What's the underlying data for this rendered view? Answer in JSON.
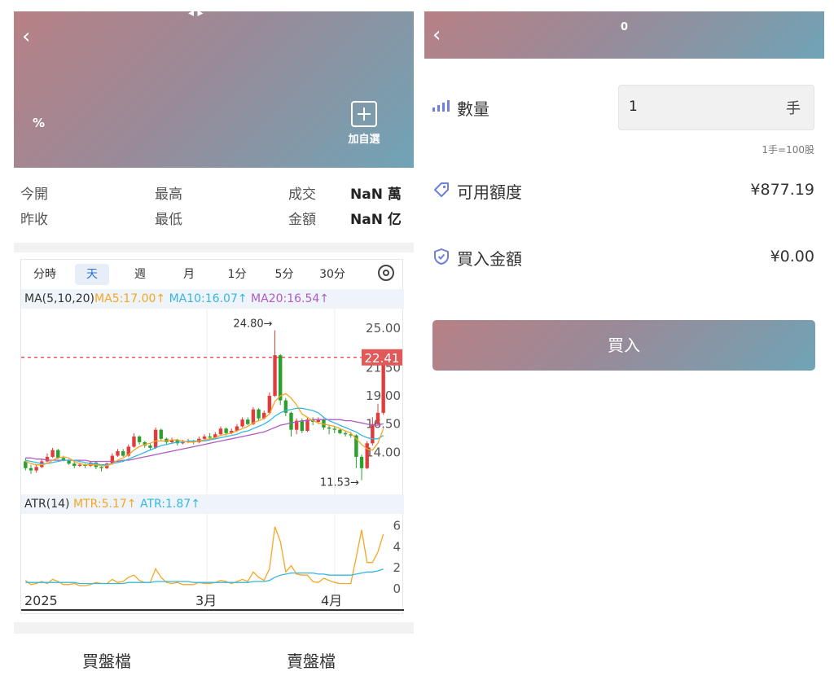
{
  "left": {
    "header": {
      "percent": "%",
      "add_favorite": "加自選"
    },
    "stats": {
      "open_label": "今開",
      "high_label": "最高",
      "volume_label": "成交",
      "volume_value": "NaN 萬",
      "prev_close_label": "昨收",
      "low_label": "最低",
      "amount_label": "金額",
      "amount_value": "NaN 亿"
    },
    "chart_tabs": [
      "分時",
      "天",
      "週",
      "月",
      "1分",
      "5分",
      "30分"
    ],
    "active_tab": "天",
    "ma_legend": {
      "name": "MA(5,10,20)",
      "ma5": "MA5:17.00↑",
      "ma10": "MA10:16.07↑",
      "ma20": "MA20:16.54↑"
    },
    "atr_legend": {
      "name": "ATR(14)",
      "mtr": "MTR:5.17↑",
      "atr": "ATR:1.87↑"
    },
    "bottom_tabs": {
      "buy": "買盤檔",
      "sell": "賣盤檔"
    },
    "colors": {
      "up": "#e23b3b",
      "down": "#2ca02c",
      "ma5": "#f5a623",
      "ma10": "#35b7e0",
      "ma20": "#b05bc0"
    }
  },
  "right": {
    "title": "0",
    "quantity_label": "數量",
    "quantity_value": "1",
    "quantity_unit": "手",
    "quantity_hint": "1手=100股",
    "available_label": "可用額度",
    "available_value": "¥877.19",
    "buy_amount_label": "買入金額",
    "buy_amount_value": "¥0.00",
    "buy_button": "買入"
  },
  "chart_data": [
    {
      "type": "candlestick",
      "title": "",
      "ylim": [
        11,
        26
      ],
      "y_ticks": [
        "25.00",
        "21.50",
        "19.00",
        "16.50",
        "14.00"
      ],
      "current_price": "22.41",
      "max_label": "24.80→",
      "min_label": "11.53→",
      "x_labels": [
        "2025",
        "3月",
        "4月"
      ],
      "candles": [
        [
          13.2,
          12.6,
          13.5,
          12.4
        ],
        [
          12.6,
          12.4,
          12.9,
          12.1
        ],
        [
          12.4,
          12.7,
          12.9,
          12.2
        ],
        [
          12.7,
          13.2,
          13.4,
          12.6
        ],
        [
          13.2,
          13.6,
          13.9,
          13.1
        ],
        [
          13.6,
          14.2,
          14.4,
          13.5
        ],
        [
          14.2,
          13.5,
          14.3,
          13.4
        ],
        [
          13.5,
          13.3,
          13.7,
          13.2
        ],
        [
          13.3,
          13.0,
          13.4,
          12.9
        ],
        [
          13.0,
          12.8,
          13.2,
          12.6
        ],
        [
          12.8,
          12.9,
          13.1,
          12.7
        ],
        [
          12.9,
          12.8,
          13.0,
          12.6
        ],
        [
          12.8,
          13.1,
          13.2,
          12.7
        ],
        [
          13.1,
          12.7,
          13.2,
          12.5
        ],
        [
          12.7,
          12.6,
          12.8,
          12.3
        ],
        [
          12.6,
          13.0,
          13.1,
          12.5
        ],
        [
          13.0,
          13.7,
          13.9,
          12.9
        ],
        [
          13.7,
          14.1,
          14.3,
          13.6
        ],
        [
          14.1,
          13.7,
          14.3,
          13.6
        ],
        [
          13.7,
          14.5,
          14.7,
          13.6
        ],
        [
          14.5,
          15.4,
          15.7,
          14.4
        ],
        [
          15.4,
          14.9,
          15.5,
          14.7
        ],
        [
          14.9,
          14.6,
          15.0,
          14.4
        ],
        [
          14.6,
          14.4,
          14.8,
          14.2
        ],
        [
          14.4,
          16.0,
          16.2,
          14.3
        ],
        [
          16.0,
          15.2,
          16.1,
          15.0
        ],
        [
          15.2,
          14.9,
          15.3,
          14.7
        ],
        [
          14.9,
          15.1,
          15.3,
          14.8
        ],
        [
          15.1,
          14.8,
          15.2,
          14.6
        ],
        [
          14.8,
          14.9,
          15.1,
          14.7
        ],
        [
          14.9,
          15.0,
          15.2,
          14.8
        ],
        [
          15.0,
          14.9,
          15.1,
          14.7
        ],
        [
          14.9,
          15.2,
          15.4,
          14.8
        ],
        [
          15.2,
          15.4,
          15.6,
          15.1
        ],
        [
          15.4,
          15.3,
          15.7,
          15.2
        ],
        [
          15.3,
          15.6,
          15.8,
          15.2
        ],
        [
          15.6,
          16.1,
          16.3,
          15.5
        ],
        [
          16.1,
          15.7,
          16.2,
          15.5
        ],
        [
          15.7,
          15.9,
          16.1,
          15.6
        ],
        [
          15.9,
          16.3,
          16.5,
          15.8
        ],
        [
          16.3,
          16.9,
          17.1,
          16.2
        ],
        [
          16.9,
          16.5,
          17.1,
          16.4
        ],
        [
          16.5,
          17.8,
          18.0,
          16.4
        ],
        [
          17.8,
          17.0,
          17.9,
          16.8
        ],
        [
          17.0,
          17.5,
          17.7,
          16.9
        ],
        [
          17.5,
          19.0,
          19.3,
          17.4
        ],
        [
          19.0,
          22.6,
          24.8,
          18.9
        ],
        [
          22.6,
          18.6,
          22.7,
          18.2
        ],
        [
          18.6,
          17.5,
          18.8,
          17.2
        ],
        [
          17.5,
          16.0,
          17.6,
          15.4
        ],
        [
          16.0,
          16.8,
          17.0,
          15.6
        ],
        [
          16.8,
          15.9,
          17.0,
          15.7
        ],
        [
          15.9,
          16.9,
          17.1,
          15.8
        ],
        [
          16.9,
          16.7,
          17.1,
          16.4
        ],
        [
          16.7,
          16.9,
          17.1,
          16.5
        ],
        [
          16.9,
          16.2,
          17.0,
          16.0
        ],
        [
          16.2,
          16.1,
          16.4,
          15.6
        ],
        [
          16.1,
          16.0,
          16.3,
          15.7
        ],
        [
          16.0,
          15.7,
          16.1,
          15.6
        ],
        [
          15.7,
          15.6,
          15.9,
          15.4
        ],
        [
          15.6,
          15.5,
          15.8,
          15.3
        ],
        [
          15.5,
          13.6,
          15.6,
          12.6
        ],
        [
          13.6,
          12.6,
          13.8,
          11.53
        ],
        [
          12.6,
          14.8,
          15.0,
          12.5
        ],
        [
          14.8,
          16.5,
          17.1,
          14.6
        ],
        [
          16.5,
          17.5,
          18.3,
          16.4
        ],
        [
          17.5,
          22.41,
          22.6,
          17.3
        ]
      ],
      "ma5": [
        13.2,
        13.0,
        12.9,
        12.9,
        13.0,
        13.3,
        13.5,
        13.6,
        13.5,
        13.2,
        13.0,
        12.9,
        12.9,
        12.9,
        12.8,
        12.8,
        13.0,
        13.3,
        13.5,
        13.8,
        14.2,
        14.5,
        14.7,
        14.8,
        15.0,
        15.0,
        15.0,
        15.1,
        15.1,
        15.0,
        14.9,
        14.9,
        15.0,
        15.1,
        15.2,
        15.3,
        15.5,
        15.6,
        15.7,
        15.9,
        16.1,
        16.3,
        16.6,
        16.8,
        17.0,
        17.4,
        18.5,
        19.0,
        19.2,
        18.8,
        18.2,
        17.4,
        17.1,
        16.8,
        16.6,
        16.5,
        16.4,
        16.3,
        16.1,
        15.9,
        15.7,
        15.2,
        14.7,
        14.3,
        14.2,
        14.8,
        16.1
      ],
      "ma10": [
        13.3,
        13.2,
        13.1,
        13.0,
        13.0,
        13.1,
        13.2,
        13.3,
        13.3,
        13.3,
        13.2,
        13.1,
        13.0,
        13.0,
        12.9,
        12.9,
        13.0,
        13.1,
        13.2,
        13.4,
        13.6,
        13.8,
        14.0,
        14.2,
        14.4,
        14.6,
        14.7,
        14.8,
        14.9,
        14.9,
        15.0,
        15.0,
        15.0,
        15.0,
        15.1,
        15.2,
        15.3,
        15.4,
        15.5,
        15.6,
        15.8,
        15.9,
        16.1,
        16.3,
        16.5,
        16.8,
        17.2,
        17.5,
        17.7,
        17.8,
        17.9,
        17.9,
        17.8,
        17.7,
        17.5,
        17.1,
        16.8,
        16.6,
        16.4,
        16.2,
        16.0,
        15.8,
        15.5,
        15.3,
        15.2,
        15.2,
        15.5
      ],
      "ma20": [
        13.5,
        13.5,
        13.4,
        13.4,
        13.3,
        13.3,
        13.3,
        13.3,
        13.3,
        13.3,
        13.3,
        13.3,
        13.2,
        13.2,
        13.2,
        13.2,
        13.2,
        13.2,
        13.3,
        13.3,
        13.4,
        13.5,
        13.6,
        13.7,
        13.8,
        13.9,
        14.0,
        14.1,
        14.2,
        14.3,
        14.4,
        14.5,
        14.6,
        14.7,
        14.8,
        14.9,
        15.0,
        15.1,
        15.2,
        15.3,
        15.4,
        15.5,
        15.6,
        15.7,
        15.8,
        16.0,
        16.2,
        16.4,
        16.5,
        16.6,
        16.7,
        16.8,
        16.8,
        16.9,
        16.9,
        16.9,
        16.9,
        16.9,
        16.9,
        16.8,
        16.8,
        16.7,
        16.6,
        16.5,
        16.4,
        16.4,
        16.54
      ]
    },
    {
      "type": "line",
      "title": "",
      "ylim": [
        0,
        6.5
      ],
      "y_ticks": [
        "6",
        "4",
        "2",
        "0"
      ],
      "series": [
        {
          "name": "MTR",
          "values": [
            0.8,
            0.4,
            0.5,
            0.7,
            0.5,
            0.9,
            0.7,
            0.4,
            0.4,
            0.5,
            0.3,
            0.3,
            0.4,
            0.6,
            0.5,
            0.5,
            0.9,
            0.6,
            0.7,
            1.1,
            1.3,
            0.8,
            0.6,
            0.6,
            1.9,
            1.1,
            0.6,
            0.5,
            0.6,
            0.4,
            0.4,
            0.4,
            0.6,
            0.5,
            0.5,
            0.6,
            0.8,
            0.7,
            0.5,
            0.7,
            0.9,
            0.7,
            1.6,
            1.1,
            0.8,
            1.9,
            5.9,
            4.5,
            1.6,
            2.2,
            1.4,
            1.3,
            1.3,
            0.7,
            0.6,
            1.0,
            0.8,
            0.6,
            0.5,
            0.5,
            0.5,
            3.0,
            5.6,
            2.5,
            2.5,
            3.5,
            5.2
          ]
        },
        {
          "name": "ATR",
          "values": [
            0.6,
            0.6,
            0.6,
            0.6,
            0.6,
            0.6,
            0.6,
            0.6,
            0.6,
            0.6,
            0.5,
            0.5,
            0.5,
            0.5,
            0.5,
            0.5,
            0.5,
            0.5,
            0.5,
            0.6,
            0.6,
            0.6,
            0.6,
            0.6,
            0.7,
            0.7,
            0.7,
            0.7,
            0.7,
            0.7,
            0.7,
            0.6,
            0.6,
            0.6,
            0.6,
            0.6,
            0.6,
            0.6,
            0.6,
            0.6,
            0.6,
            0.6,
            0.7,
            0.7,
            0.7,
            0.8,
            1.1,
            1.3,
            1.4,
            1.5,
            1.5,
            1.5,
            1.5,
            1.5,
            1.4,
            1.4,
            1.3,
            1.3,
            1.3,
            1.3,
            1.3,
            1.4,
            1.5,
            1.6,
            1.6,
            1.7,
            1.87
          ]
        }
      ]
    }
  ]
}
